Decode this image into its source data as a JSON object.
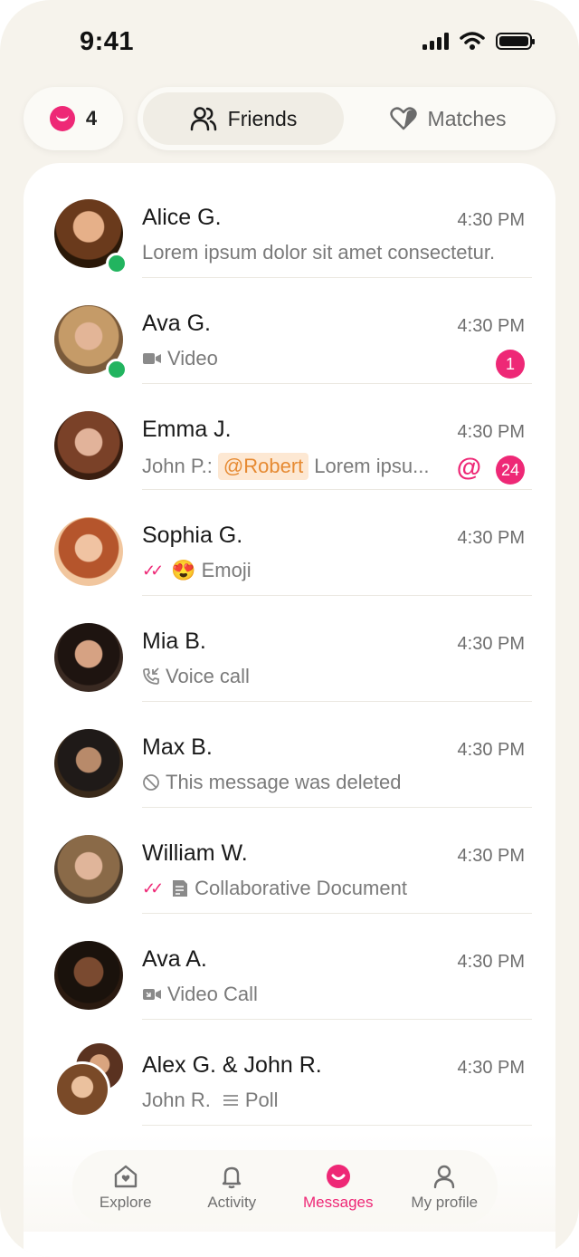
{
  "status_bar": {
    "time": "9:41"
  },
  "header": {
    "notification_count": "4",
    "tabs": [
      {
        "label": "Friends",
        "icon": "people-icon",
        "active": true
      },
      {
        "label": "Matches",
        "icon": "heart-icon",
        "active": false
      }
    ]
  },
  "conversations": [
    {
      "name": "Alice G.",
      "time": "4:30 PM",
      "preview": "Lorem ipsum dolor sit amet consectetur.",
      "online": true
    },
    {
      "name": "Ava G.",
      "time": "4:30 PM",
      "preview": "Video",
      "preview_icon": "video-icon",
      "badge": "1",
      "online": true
    },
    {
      "name": "Emma J.",
      "time": "4:30 PM",
      "sender": "John P.:",
      "mention": "@Robert",
      "preview": "Lorem ipsu...",
      "badge": "24",
      "mention_icon": "@"
    },
    {
      "name": "Sophia G.",
      "time": "4:30 PM",
      "preview": "Emoji",
      "emoji": "😍",
      "status_icon": "double-check-icon"
    },
    {
      "name": "Mia B.",
      "time": "4:30 PM",
      "preview": "Voice call",
      "preview_icon": "phone-incoming-icon"
    },
    {
      "name": "Max B.",
      "time": "4:30 PM",
      "preview": "This message was deleted",
      "preview_icon": "blocked-icon"
    },
    {
      "name": "William W.",
      "time": "4:30 PM",
      "preview": "Collaborative Document",
      "preview_icon": "document-icon",
      "status_icon": "double-check-icon"
    },
    {
      "name": "Ava A.",
      "time": "4:30 PM",
      "preview": "Video Call",
      "preview_icon": "video-call-icon"
    },
    {
      "name": "Alex G. & John R.",
      "time": "4:30 PM",
      "sender": "John R.",
      "preview": "Poll",
      "preview_icon": "poll-icon"
    }
  ],
  "nav": [
    {
      "label": "Explore",
      "icon": "home-heart-icon",
      "active": false
    },
    {
      "label": "Activity",
      "icon": "bell-icon",
      "active": false
    },
    {
      "label": "Messages",
      "icon": "messages-icon",
      "active": true
    },
    {
      "label": "My profile",
      "icon": "person-icon",
      "active": false
    }
  ],
  "colors": {
    "accent": "#ee2876",
    "online": "#22b45f",
    "background": "#f6f3ec"
  }
}
